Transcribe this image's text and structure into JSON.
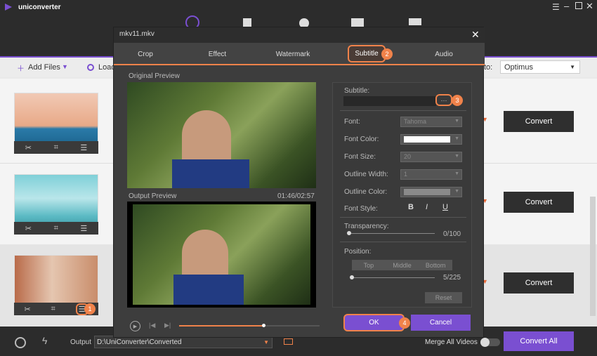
{
  "app": {
    "title": "uniconverter"
  },
  "toolbar": {
    "add_files": "Add Files",
    "load": "Load",
    "to_label": "to:",
    "optimus": "Optimus"
  },
  "items": [
    {
      "convert": "Convert"
    },
    {
      "convert": "Convert"
    },
    {
      "convert": "Convert"
    }
  ],
  "bottom": {
    "output_label": "Output",
    "output_path": "D:\\UniConverter\\Converted",
    "merge_label": "Merge All Videos",
    "convert_all": "Convert All"
  },
  "dialog": {
    "title": "mkv11.mkv",
    "tabs": [
      "Crop",
      "Effect",
      "Watermark",
      "Subtitle",
      "Audio"
    ],
    "original_preview": "Original Preview",
    "output_preview": "Output Preview",
    "time": "01:46/02:57",
    "subtitle_label": "Subtitle:",
    "browse": "···",
    "font_label": "Font:",
    "font_value": "Tahoma",
    "font_color_label": "Font Color:",
    "font_size_label": "Font Size:",
    "font_size_value": "20",
    "outline_width_label": "Outline Width:",
    "outline_width_value": "1",
    "outline_color_label": "Outline Color:",
    "font_style_label": "Font Style:",
    "bold": "B",
    "italic": "I",
    "underline": "U",
    "transparency_label": "Transparency:",
    "transparency_value": "0/100",
    "position_label": "Position:",
    "pos_top": "Top",
    "pos_middle": "Middle",
    "pos_bottom": "Bottom",
    "position_value": "5/225",
    "reset": "Reset",
    "ok": "OK",
    "cancel": "Cancel"
  },
  "markers": [
    "1",
    "2",
    "3",
    "4"
  ],
  "colors": {
    "accent": "#7a4fd1",
    "highlight": "#f0824a"
  }
}
